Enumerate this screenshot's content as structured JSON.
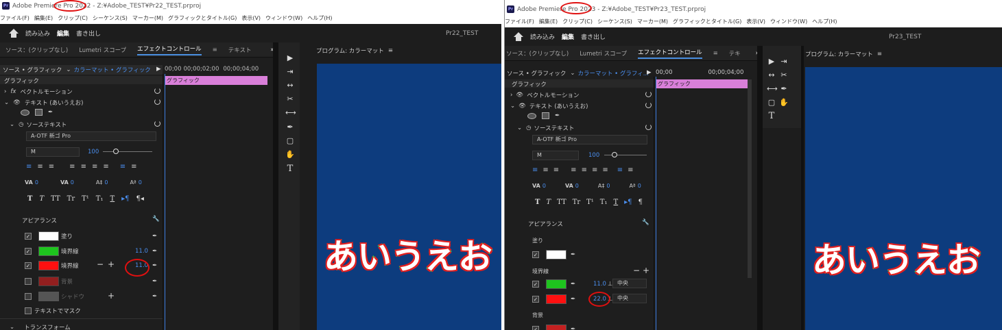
{
  "left": {
    "title": "Adobe Premiere Pro 2022 - Z:¥Adobe_TEST¥Pr22_TEST.prproj",
    "menu": [
      "ファイル(F)",
      "編集(E)",
      "クリップ(C)",
      "シーケンス(S)",
      "マーカー(M)",
      "グラフィックとタイトル(G)",
      "表示(V)",
      "ウィンドウ(W)",
      "ヘルプ(H)"
    ],
    "workspaces": [
      "読み込み",
      "編集",
      "書き出し"
    ],
    "project": "Pr22_TEST",
    "panel_tabs": [
      "ソース：(クリップなし)",
      "Lumetri スコープ",
      "エフェクトコントロール",
      "テキスト"
    ],
    "src_label": "ソース • グラフィック",
    "seq_label": "カラーマット • グラフィック",
    "timecodes": [
      "00;00",
      "00;00;02;00",
      "00;00;04;00"
    ],
    "clip": "グラフィック",
    "section": "グラフィック",
    "vector": "ベクトルモーション",
    "text_layer": "テキスト (あいうえお)",
    "source_text": "ソーステキスト",
    "font": "A-OTF 新ゴ Pro",
    "weight": "M",
    "size": "100",
    "zero": "0",
    "appearance": "アピアランス",
    "fill": "塗り",
    "stroke": "境界線",
    "stroke_value": "11.0",
    "stroke2_value": "11.0",
    "bg": "背景",
    "shadow": "シャドウ",
    "mask": "テキストでマスク",
    "transform": "トランスフォーム",
    "program": "プログラム: カラーマット",
    "text": "あいうえお",
    "fx": "fx"
  },
  "right": {
    "title": "Adobe Premiere Pro 2023 - Z:¥Adobe_TEST¥Pr23_TEST.prproj",
    "menu": [
      "ファイル(F)",
      "編集(E)",
      "クリップ(C)",
      "シーケンス(S)",
      "マーカー(M)",
      "グラフィックとタイトル(G)",
      "表示(V)",
      "ウィンドウ(W)",
      "ヘルプ(H)"
    ],
    "workspaces": [
      "読み込み",
      "編集",
      "書き出し"
    ],
    "project": "Pr23_TEST",
    "panel_tabs": [
      "ソース：(クリップなし)",
      "Lumetri スコープ",
      "エフェクトコントロール",
      "テキ"
    ],
    "src_label": "ソース • グラフィック",
    "seq_label": "カラーマット • グラフィ...",
    "timecodes": [
      "00;00",
      "00;00;04;00"
    ],
    "clip": "グラフィック",
    "section": "グラフィック",
    "vector": "ベクトルモーション",
    "text_layer": "テキスト (あいうえお)",
    "source_text": "ソーステキスト",
    "font": "A-OTF 新ゴ Pro",
    "weight": "M",
    "size": "100",
    "zero": "0",
    "appearance": "アピアランス",
    "fill": "塗り",
    "stroke": "境界線",
    "stroke_value": "11.0",
    "stroke2_value": "22.0",
    "center": "中央",
    "bg": "背景",
    "program": "プログラム: カラーマット",
    "text": "あいうえお"
  },
  "colors": {
    "fill_white": "#ffffff",
    "stroke_green": "#1ec41e",
    "stroke_red": "#ff1010",
    "bg_red": "#c42020",
    "shadow_gray": "#555555",
    "monitor_blue": "#0d3c7e",
    "clip_pink": "#d97fd9",
    "accent_blue": "#4a8ff0"
  }
}
